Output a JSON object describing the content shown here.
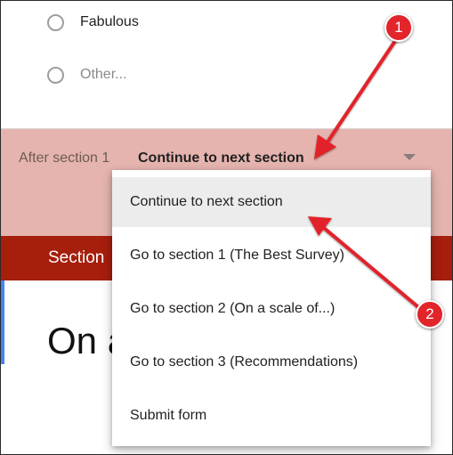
{
  "options": [
    {
      "label": "Fabulous",
      "muted": false
    },
    {
      "label": "Other...",
      "muted": true
    }
  ],
  "after_section": {
    "label": "After section 1",
    "value": "Continue to next section"
  },
  "section_bar": {
    "title": "Section"
  },
  "content": {
    "big_text": "On a"
  },
  "menu": {
    "items": [
      {
        "label": "Continue to next section",
        "selected": true
      },
      {
        "label": "Go to section 1 (The Best Survey)"
      },
      {
        "label": "Go to section 2 (On a scale of...)"
      },
      {
        "label": "Go to section 3 (Recommendations)"
      },
      {
        "label": "Submit form"
      }
    ]
  },
  "annotations": {
    "badge_1": "1",
    "badge_2": "2",
    "color": "#e2242b"
  },
  "colors": {
    "band": "#e5b4ae",
    "section_bar": "#a61e0c",
    "accent_blue": "#4285f4",
    "selected_item": "#ececec"
  }
}
